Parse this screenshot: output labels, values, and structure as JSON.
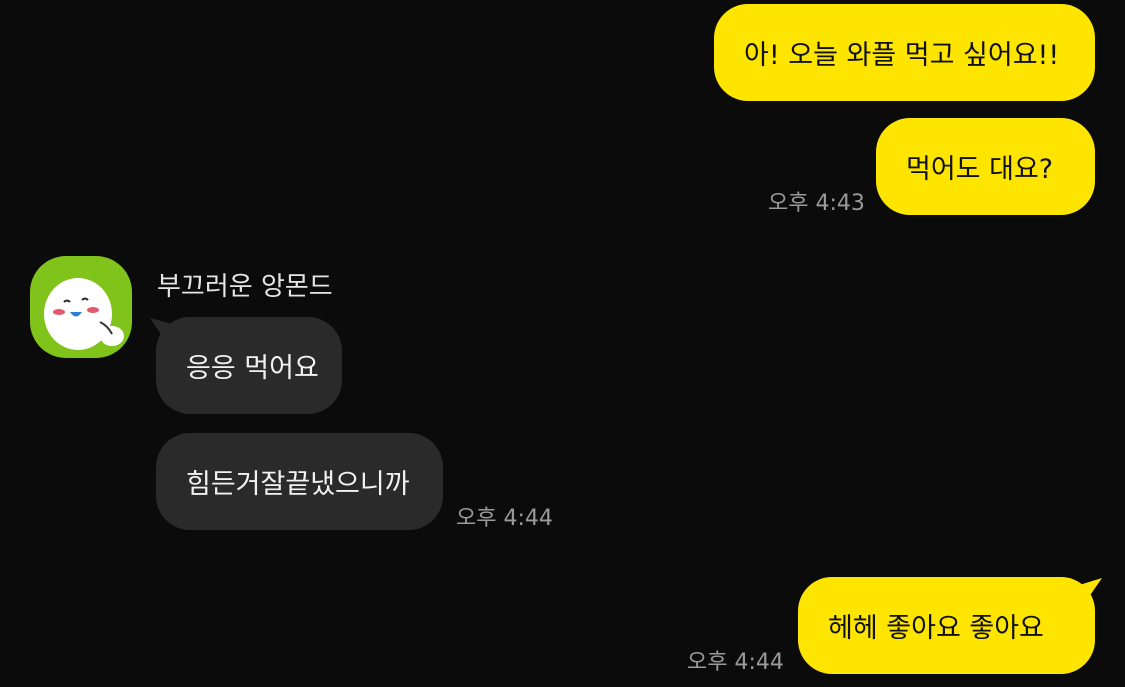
{
  "chat": {
    "messages": [
      {
        "text": "아! 오늘 와플 먹고 싶어요!!"
      },
      {
        "text": "먹어도 대요?",
        "time": "오후 4:43"
      },
      {
        "text": "응응 먹어요"
      },
      {
        "text": "힘든거잘끝냈으니까",
        "time": "오후 4:44"
      },
      {
        "text": "헤헤 좋아요 좋아요",
        "time": "오후 4:44"
      }
    ],
    "contact_name": "부끄러운 앙몬드"
  },
  "colors": {
    "background": "#0b0b0b",
    "my_bubble": "#fee500",
    "their_bubble": "#2a2a2a",
    "avatar_bg": "#7fc31b",
    "timestamp": "#9a9a9a"
  },
  "icons": {
    "avatar": "shy-character-avatar-icon"
  }
}
